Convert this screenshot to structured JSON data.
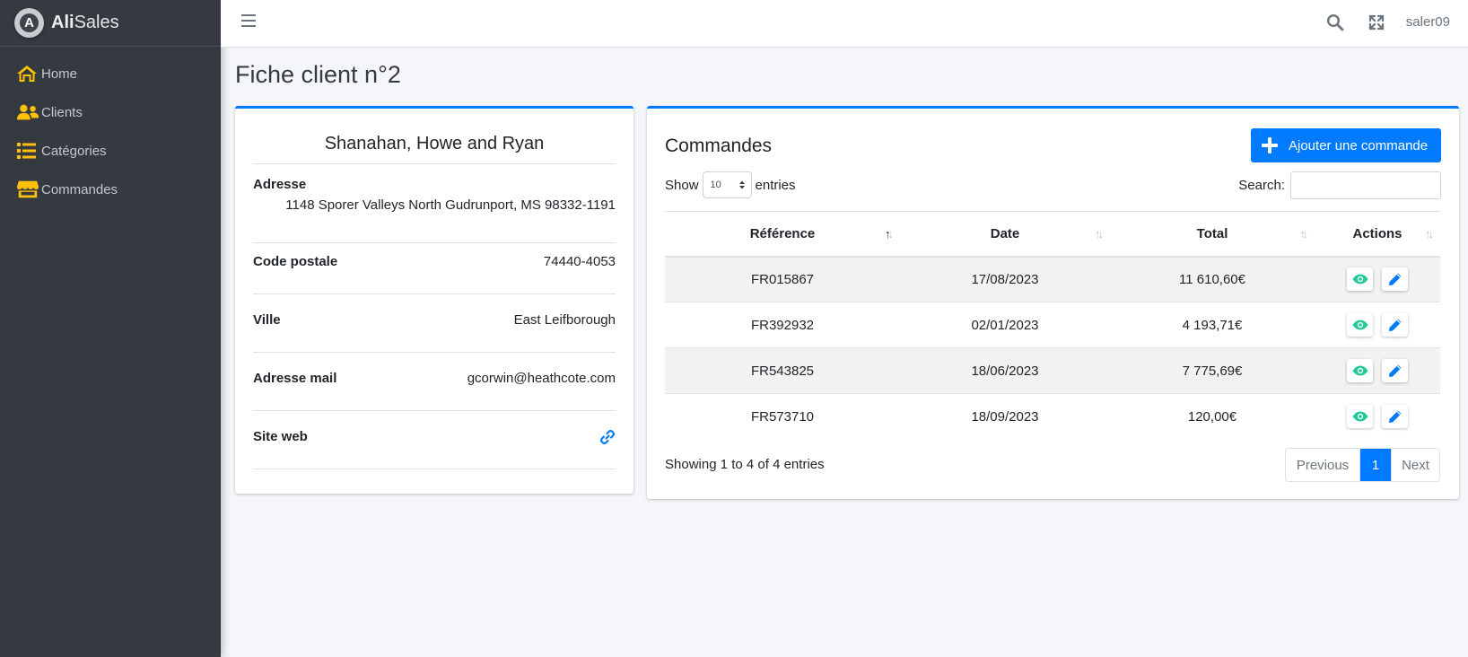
{
  "brand": {
    "prefix": "Ali",
    "suffix": "Sales",
    "logo_letter": "A"
  },
  "sidebar": {
    "items": [
      {
        "label": "Home",
        "icon": "home-icon"
      },
      {
        "label": "Clients",
        "icon": "users-icon"
      },
      {
        "label": "Catégories",
        "icon": "list-icon"
      },
      {
        "label": "Commandes",
        "icon": "store-icon"
      }
    ]
  },
  "topbar": {
    "username": "saler09"
  },
  "page": {
    "title": "Fiche client n°2"
  },
  "client": {
    "name": "Shanahan, Howe and Ryan",
    "address_label": "Adresse",
    "address_value": "1148 Sporer Valleys North Gudrunport, MS 98332-1191",
    "postal_label": "Code postale",
    "postal_value": "74440-4053",
    "city_label": "Ville",
    "city_value": "East Leifborough",
    "email_label": "Adresse mail",
    "email_value": "gcorwin@heathcote.com",
    "website_label": "Site web"
  },
  "orders": {
    "title": "Commandes",
    "add_button": "Ajouter une commande",
    "show_label": "Show",
    "entries_label": "entries",
    "page_length": "10",
    "search_label": "Search:",
    "columns": [
      "Référence",
      "Date",
      "Total",
      "Actions"
    ],
    "rows": [
      {
        "ref": "FR015867",
        "date": "17/08/2023",
        "total": "11 610,60€"
      },
      {
        "ref": "FR392932",
        "date": "02/01/2023",
        "total": "4 193,71€"
      },
      {
        "ref": "FR543825",
        "date": "18/06/2023",
        "total": "7 775,69€"
      },
      {
        "ref": "FR573710",
        "date": "18/09/2023",
        "total": "120,00€"
      }
    ],
    "info": "Showing 1 to 4 of 4 entries",
    "pagination": {
      "previous": "Previous",
      "current": "1",
      "next": "Next"
    }
  },
  "colors": {
    "accent": "#007bff",
    "sidebar_bg": "#343a40",
    "icon_yellow": "#ffc107",
    "view_green": "#20c997"
  }
}
